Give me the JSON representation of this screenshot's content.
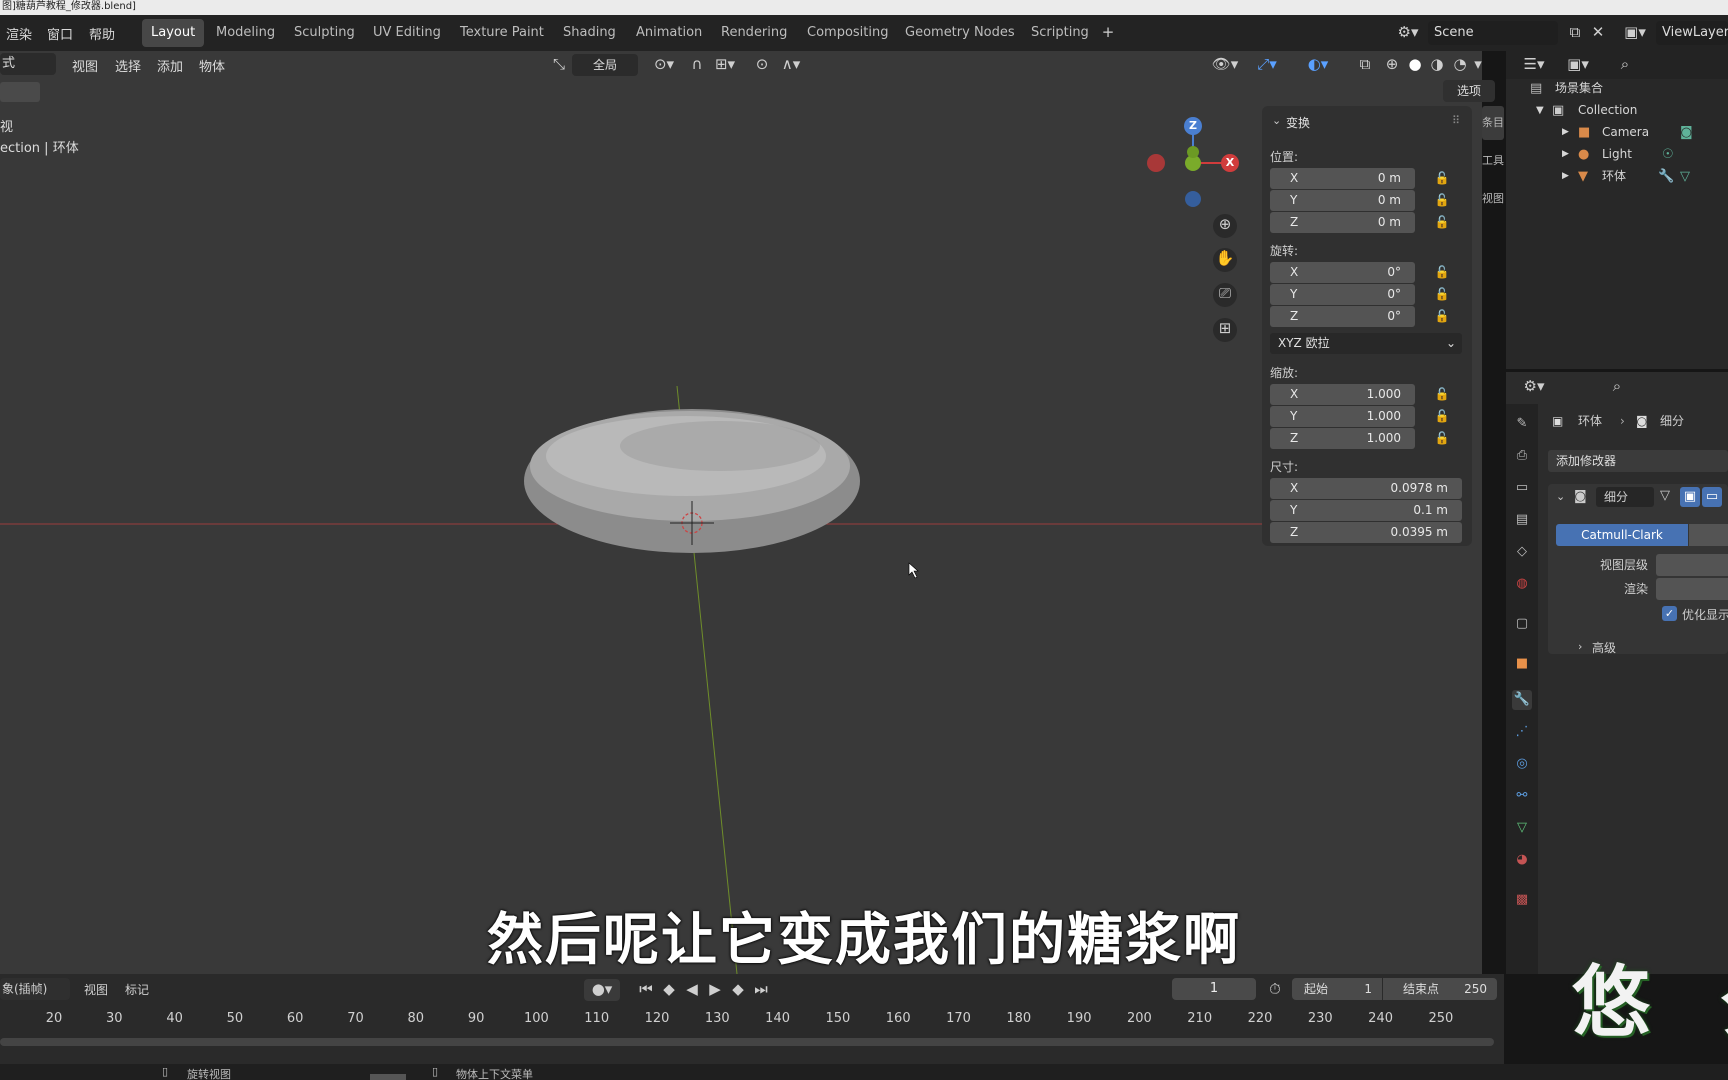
{
  "title_bar": "图]糖葫芦教程_修改器.blend]",
  "menus": [
    "渲染",
    "窗口",
    "帮助"
  ],
  "workspaces": [
    "Layout",
    "Modeling",
    "Sculpting",
    "UV Editing",
    "Texture Paint",
    "Shading",
    "Animation",
    "Rendering",
    "Compositing",
    "Geometry Nodes",
    "Scripting"
  ],
  "scene_label": "Scene",
  "viewlayer_label": "ViewLayer",
  "viewport_header": {
    "mode": "式",
    "menu_items": [
      "视图",
      "选择",
      "添加",
      "物体"
    ],
    "transform_orientation": "全局",
    "options": "选项"
  },
  "viewport_info": {
    "line1": "视",
    "line2": "ection | 环体"
  },
  "gizmo": {
    "x": "X",
    "y": "Y",
    "z": "Z"
  },
  "transform_panel": {
    "title": "变换",
    "location_label": "位置:",
    "location": {
      "x": "0 m",
      "y": "0 m",
      "z": "0 m"
    },
    "rotation_label": "旋转:",
    "rotation": {
      "x": "0°",
      "y": "0°",
      "z": "0°"
    },
    "rotation_mode": "XYZ 欧拉",
    "scale_label": "缩放:",
    "scale": {
      "x": "1.000",
      "y": "1.000",
      "z": "1.000"
    },
    "dimensions_label": "尺寸:",
    "dimensions": {
      "x": "0.0978 m",
      "y": "0.1 m",
      "z": "0.0395 m"
    },
    "axis": {
      "x": "X",
      "y": "Y",
      "z": "Z"
    }
  },
  "sidebar_tabs": [
    "条目",
    "工具",
    "视图"
  ],
  "outliner": {
    "scene_collection": "场景集合",
    "collection": "Collection",
    "items": [
      "Camera",
      "Light",
      "环体"
    ]
  },
  "properties": {
    "breadcrumb_object": "环体",
    "breadcrumb_modifier": "细分",
    "add_modifier": "添加修改器",
    "modifier_name": "细分",
    "subdivision_type": "Catmull-Clark",
    "viewport_levels_label": "视图层级",
    "render_label": "渲染",
    "optimal_display_label": "优化显示",
    "optimal_display_checked": true,
    "advanced_label": "高级"
  },
  "timeline": {
    "mode": "象(插帧)",
    "view": "视图",
    "marker": "标记",
    "current_frame": "1",
    "start_label": "起始",
    "start": "1",
    "end_label": "结束点",
    "end": "250",
    "ticks": [
      "20",
      "30",
      "40",
      "50",
      "60",
      "70",
      "80",
      "90",
      "100",
      "110",
      "120",
      "130",
      "140",
      "150",
      "160",
      "170",
      "180",
      "190",
      "200",
      "210",
      "220",
      "230",
      "240",
      "250"
    ]
  },
  "status_bar": {
    "rotate_view": "旋转视图",
    "context_menu": "物体上下文菜单"
  },
  "subtitle": "然后呢让它变成我们的糖浆啊",
  "watermark": "悠 夕"
}
